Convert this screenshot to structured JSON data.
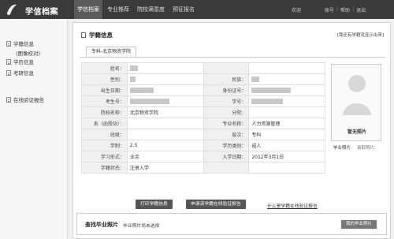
{
  "header": {
    "app_title": "学信档案",
    "nav": [
      "学信档案",
      "专业推荐",
      "院校满意度",
      "预征报名"
    ],
    "welcome": "欢迎",
    "links": [
      "账号",
      "帮助",
      "退出"
    ]
  },
  "sidebar": {
    "items": [
      {
        "label": "学籍信息",
        "sub": "(图像校对)"
      },
      {
        "label": "学历信息"
      },
      {
        "label": "考研信息"
      },
      {
        "label": "在线验证报告"
      }
    ]
  },
  "panel": {
    "title": "学籍信息",
    "title_link": "[我还有学籍没显示出来]",
    "tab": "专科-北京物资学院"
  },
  "info_rows": [
    {
      "k1": "姓名：",
      "v1": "",
      "k2": "",
      "v2": ""
    },
    {
      "k1": "性别：",
      "v1": "",
      "k2": "民族：",
      "v2": ""
    },
    {
      "k1": "出生日期：",
      "v1": "",
      "k2": "身份证号：",
      "v2": ""
    },
    {
      "k1": "考生号：",
      "v1": "",
      "k2": "学号：",
      "v2": ""
    },
    {
      "k1": "院校名称：",
      "v1": "北京物资学院",
      "k2": "分院：",
      "v2": ""
    },
    {
      "k1": "系（函授站）：",
      "v1": "",
      "k2": "专业名称：",
      "v2": "人力资源管理"
    },
    {
      "k1": "班级：",
      "v1": "",
      "k2": "层次：",
      "v2": "专科"
    },
    {
      "k1": "学制：",
      "v1": "2.5",
      "k2": "学历类别：",
      "v2": "成人"
    },
    {
      "k1": "学习形式：",
      "v1": "业余",
      "k2": "入学日期：",
      "v2": "2012年3月1日"
    },
    {
      "k1": "学籍状态：",
      "v1": "注册入学",
      "k2": "",
      "v2": ""
    }
  ],
  "photo": {
    "caption": "暂无照片",
    "label": "毕业照片",
    "upload": "录取照片"
  },
  "buttons": {
    "print": "打印学籍信息",
    "apply": "申请该学籍在线验证报告",
    "what_is": "什么是学籍在线验证报告"
  },
  "grad_photo": {
    "title": "查找毕业照片",
    "status": "毕业照片尚未选择",
    "button": "我的毕业照片"
  },
  "colors": {
    "header_bg": "#3a3a3a",
    "button_bg": "#555555",
    "accent": "#5a5a5a"
  }
}
